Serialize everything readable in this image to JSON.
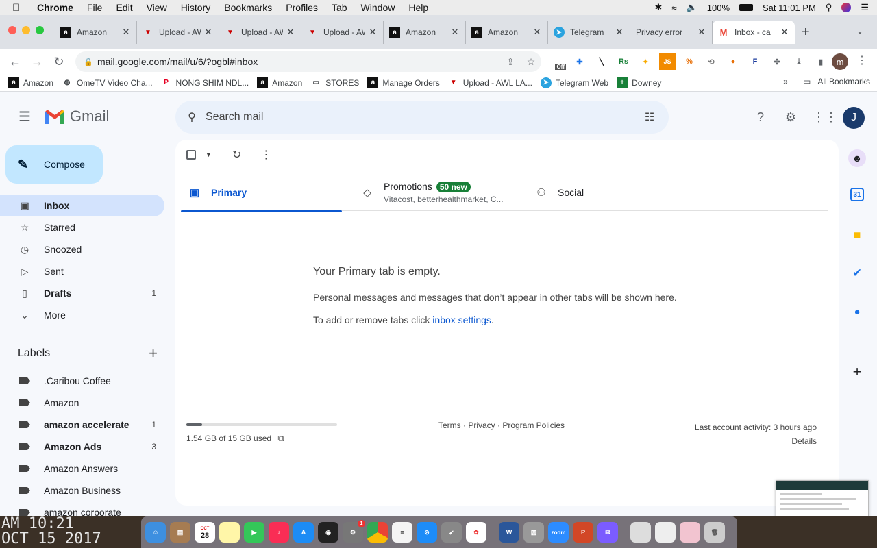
{
  "menubar": {
    "app_name": "Chrome",
    "items": [
      "File",
      "Edit",
      "View",
      "History",
      "Bookmarks",
      "Profiles",
      "Tab",
      "Window",
      "Help"
    ],
    "battery": "100%",
    "clock": "Sat 11:01 PM"
  },
  "tabs": [
    {
      "title": "Amazon",
      "icon": "amazon-icon"
    },
    {
      "title": "Upload - AWL",
      "icon": "awl-icon"
    },
    {
      "title": "Upload - AWL",
      "icon": "awl-icon"
    },
    {
      "title": "Upload - AWL",
      "icon": "awl-icon"
    },
    {
      "title": "Amazon",
      "icon": "amazon-icon"
    },
    {
      "title": "Amazon",
      "icon": "amazon-icon"
    },
    {
      "title": "Telegram",
      "icon": "telegram-icon"
    },
    {
      "title": "Privacy error",
      "icon": "warning-icon"
    },
    {
      "title": "Inbox - ca",
      "icon": "gmail-icon"
    }
  ],
  "toolbar": {
    "url": "mail.google.com/mail/u/6/?ogbl#inbox",
    "profile_initial": "m",
    "ext_off_label": "Off"
  },
  "bookmarks": [
    {
      "label": "Amazon",
      "icon": "amazon-icon"
    },
    {
      "label": "OmeTV Video Cha...",
      "icon": "globe-icon"
    },
    {
      "label": "NONG SHIM NDL...",
      "icon": "pinterest-icon"
    },
    {
      "label": "Amazon",
      "icon": "amazon-icon"
    },
    {
      "label": "STORES",
      "icon": "folder-icon"
    },
    {
      "label": "Manage Orders",
      "icon": "amazon-icon"
    },
    {
      "label": "Upload - AWL LA...",
      "icon": "awl-icon"
    },
    {
      "label": "Telegram Web",
      "icon": "telegram-icon"
    },
    {
      "label": "Downey",
      "icon": "sheets-icon"
    }
  ],
  "bookmarks_overflow": "»",
  "all_bookmarks": "All Bookmarks",
  "gmail": {
    "product_name": "Gmail",
    "search_placeholder": "Search mail",
    "account_initial": "J",
    "compose_label": "Compose",
    "nav": [
      {
        "label": "Inbox",
        "icon": "inbox-icon",
        "count": "",
        "active": true,
        "bold": true
      },
      {
        "label": "Starred",
        "icon": "star-icon",
        "count": "",
        "active": false,
        "bold": false
      },
      {
        "label": "Snoozed",
        "icon": "clock-icon",
        "count": "",
        "active": false,
        "bold": false
      },
      {
        "label": "Sent",
        "icon": "send-icon",
        "count": "",
        "active": false,
        "bold": false
      },
      {
        "label": "Drafts",
        "icon": "draft-icon",
        "count": "1",
        "active": false,
        "bold": true
      },
      {
        "label": "More",
        "icon": "chevron-down-icon",
        "count": "",
        "active": false,
        "bold": false
      }
    ],
    "labels_heading": "Labels",
    "labels": [
      {
        "label": ".Caribou Coffee",
        "count": "",
        "bold": false
      },
      {
        "label": "Amazon",
        "count": "",
        "bold": false
      },
      {
        "label": "amazon accelerate",
        "count": "1",
        "bold": true
      },
      {
        "label": "Amazon Ads",
        "count": "3",
        "bold": true
      },
      {
        "label": "Amazon Answers",
        "count": "",
        "bold": false
      },
      {
        "label": "Amazon Business",
        "count": "",
        "bold": false
      },
      {
        "label": "amazon corporate",
        "count": "",
        "bold": false
      }
    ],
    "categories": {
      "primary": "Primary",
      "promotions": "Promotions",
      "promotions_badge": "50 new",
      "promotions_sub": "Vitacost, betterhealthmarket, C...",
      "social": "Social"
    },
    "empty_title": "Your Primary tab is empty.",
    "empty_body": "Personal messages and messages that don’t appear in other tabs will be shown here.",
    "empty_settings_prefix": "To add or remove tabs click",
    "empty_settings_link": "inbox settings",
    "empty_settings_suffix": ".",
    "storage_used": "1.54 GB of 15 GB used",
    "storage_fraction": 0.103,
    "footer_links": "Terms · Privacy · Program Policies",
    "last_activity": "Last account activity: 3 hours ago",
    "details": "Details"
  },
  "desktop_clock": "AM 10:21\nOCT 15 2017",
  "dock": {
    "calendar_month": "OCT",
    "calendar_day": "28",
    "zoom_label": "zoom",
    "badge_count": "1"
  },
  "colors": {
    "accent": "#0b57d0",
    "compose_bg": "#c2e7ff",
    "active_nav": "#d3e3fd",
    "badge_green": "#188038"
  }
}
